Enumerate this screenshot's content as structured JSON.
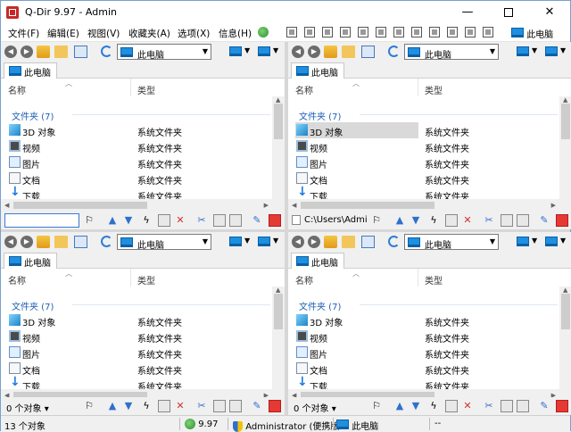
{
  "window": {
    "title": "Q-Dir 9.97 - Admin",
    "min_glyph": "—",
    "close_glyph": "✕"
  },
  "menu": {
    "items": [
      "文件(F)",
      "编辑(E)",
      "视图(V)",
      "收藏夹(A)",
      "选项(X)",
      "信息(H)"
    ],
    "right_label": "此电脑"
  },
  "pane": {
    "address": "此电脑",
    "tab_label": "此电脑",
    "columns": {
      "name": "名称",
      "type": "类型"
    },
    "group_label": "文件夹 (7)",
    "rows": [
      {
        "name": "3D 对象",
        "type": "系统文件夹",
        "icon": "3d-objects-icon"
      },
      {
        "name": "视频",
        "type": "系统文件夹",
        "icon": "video-icon"
      },
      {
        "name": "图片",
        "type": "系统文件夹",
        "icon": "pictures-icon"
      },
      {
        "name": "文档",
        "type": "系统文件夹",
        "icon": "documents-icon"
      },
      {
        "name": "下载",
        "type": "系统文件夹",
        "icon": "downloads-icon"
      }
    ]
  },
  "strips": {
    "top_right_path": "C:\\Users\\Admi",
    "bottom_status": "0 个对象"
  },
  "statusbar": {
    "count": "13 个对象",
    "version": "9.97",
    "user": "Administrator (便携版",
    "location": "此电脑",
    "extra": "--"
  },
  "colors": {
    "accent": "#1e5fb4",
    "selected_row": "#d9d9d9",
    "close_button": "#e53935"
  }
}
